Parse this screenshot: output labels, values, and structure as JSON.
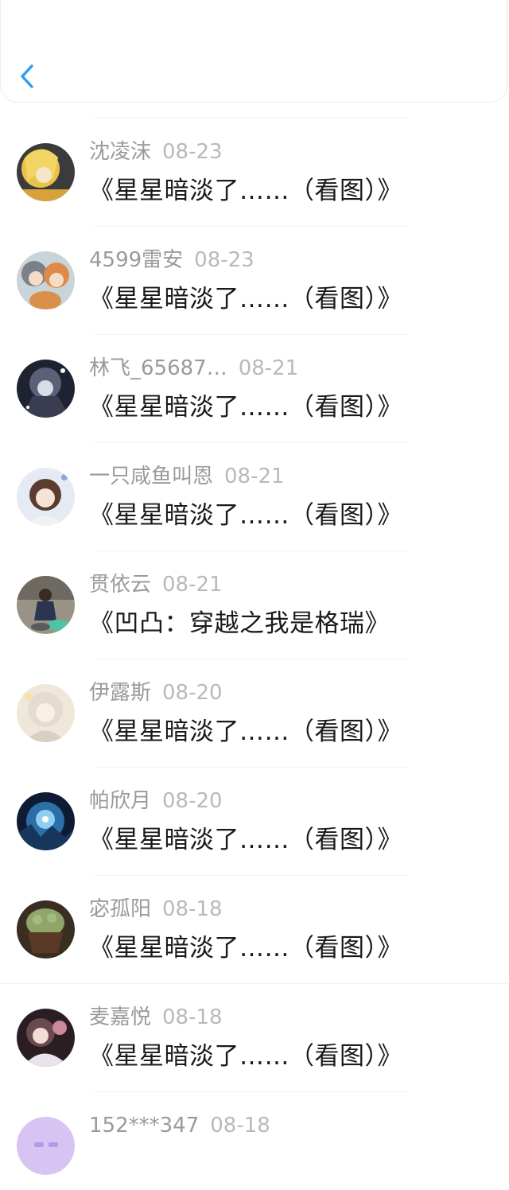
{
  "header": {
    "back_icon": "chevron-left-icon",
    "accent_color": "#2a9ef4"
  },
  "items": [
    {
      "name": "沈凌沫",
      "date": "08-23",
      "title": "《星星暗淡了……（看图）》"
    },
    {
      "name": "4599雷安",
      "date": "08-23",
      "title": "《星星暗淡了……（看图）》"
    },
    {
      "name": "林飞_65687…",
      "date": "08-21",
      "title": "《星星暗淡了……（看图）》"
    },
    {
      "name": "一只咸鱼叫恩",
      "date": "08-21",
      "title": "《星星暗淡了……（看图）》"
    },
    {
      "name": "贯依云",
      "date": "08-21",
      "title": "《凹凸：穿越之我是格瑞》"
    },
    {
      "name": "伊露斯",
      "date": "08-20",
      "title": "《星星暗淡了……（看图）》"
    },
    {
      "name": "帕欣月",
      "date": "08-20",
      "title": "《星星暗淡了……（看图）》"
    },
    {
      "name": "宓孤阳",
      "date": "08-18",
      "title": "《星星暗淡了……（看图）》"
    },
    {
      "name": "麦嘉悦",
      "date": "08-18",
      "title": "《星星暗淡了……（看图）》"
    },
    {
      "name": "152***347",
      "date": "08-18",
      "title": ""
    }
  ]
}
